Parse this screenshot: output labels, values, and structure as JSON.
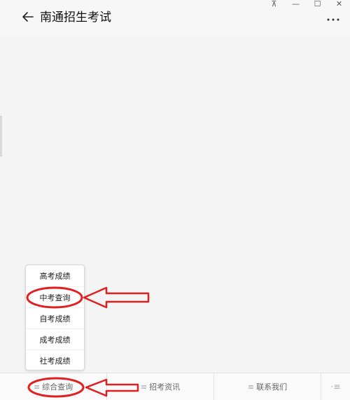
{
  "window": {
    "controls": [
      "⊼",
      "—",
      "☐",
      "✕"
    ]
  },
  "header": {
    "title": "南通招生考试",
    "more": "···"
  },
  "popup": {
    "items": [
      {
        "label": "高考成绩"
      },
      {
        "label": "中考查询"
      },
      {
        "label": "自考成绩"
      },
      {
        "label": "成考成绩"
      },
      {
        "label": "社考成绩"
      }
    ]
  },
  "bottom_bar": {
    "menu_glyph": "≡",
    "tabs": [
      {
        "label": "综合查询"
      },
      {
        "label": "招考资讯"
      },
      {
        "label": "联系我们"
      }
    ],
    "keyboard_toggle": "⋅≡"
  },
  "colors": {
    "annotation_red": "#e02020",
    "background": "#f4f4f4"
  }
}
